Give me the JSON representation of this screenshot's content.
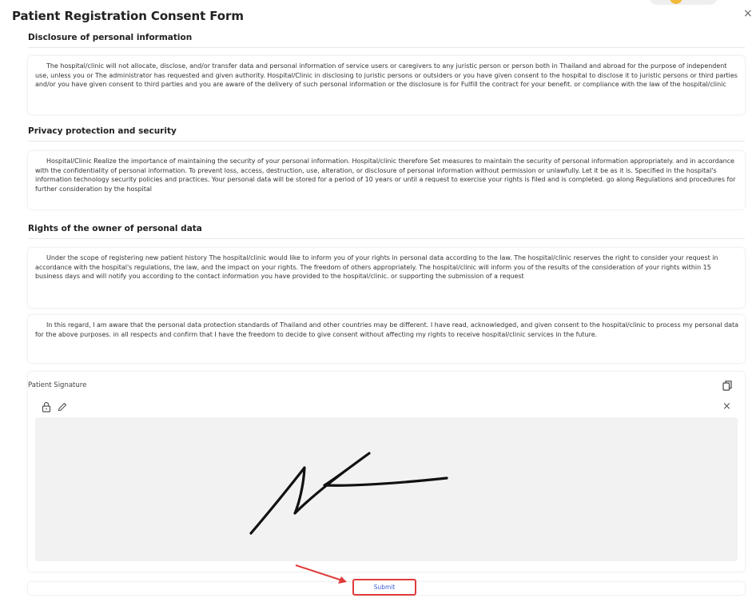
{
  "header": {
    "title": "Patient Registration Consent Form",
    "close_icon": "×"
  },
  "sections": [
    {
      "heading": "Disclosure of personal information",
      "paragraph": "The hospital/clinic will not allocate, disclose, and/or transfer data and personal information of service users or caregivers to any juristic person or person both in Thailand and abroad for the purpose of independent use, unless you or The administrator has requested and given authority. Hospital/Clinic in disclosing to juristic persons or outsiders or you have given consent to the hospital to disclose it to juristic persons or third parties and/or you have given consent to third parties and you are aware of the delivery of such personal information or the disclosure is for Fulfill the contract for your benefit. or compliance with the law of the hospital/clinic"
    },
    {
      "heading": "Privacy protection and security",
      "paragraph": "Hospital/Clinic Realize the importance of maintaining the security of your personal information. Hospital/clinic therefore Set measures to maintain the security of personal information appropriately. and in accordance with the confidentiality of personal information. To prevent loss, access, destruction, use, alteration, or disclosure of personal information without permission or unlawfully. Let it be as it is. Specified in the hospital's information technology security policies and practices. Your personal data will be stored for a period of 10 years or until a request to exercise your rights is filed and is completed. go along Regulations and procedures for further consideration by the hospital"
    },
    {
      "heading": "Rights of the owner of personal data",
      "paragraph": "Under the scope of registering new patient history The hospital/clinic would like to inform you of your rights in personal data according to the law. The hospital/clinic reserves the right to consider your request in accordance with the hospital's regulations, the law, and the impact on your rights. The freedom of others appropriately. The hospital/clinic will inform you of the results of the consideration of your rights within 15 business days and will notify you according to the contact information you have provided to the hospital/clinic. or supporting the submission of a request"
    }
  ],
  "consent_paragraph": "In this regard, I am aware that the personal data protection standards of Thailand and other countries may be different. I have read, acknowledged, and given consent to the hospital/clinic to process my personal data for the above purposes. in all respects and confirm that I have the freedom to decide to give consent without affecting my rights to receive hospital/clinic services in the future.",
  "signature": {
    "label": "Patient Signature",
    "icons": [
      "copy-icon",
      "lock-icon",
      "pencil-icon",
      "clear-icon"
    ],
    "clear_glyph": "×"
  },
  "submit": {
    "label": "Submit"
  },
  "colors": {
    "annotation_red": "#e03b3b",
    "submit_text": "#3d5bd8",
    "pad_background": "#f2f2f2",
    "badge_yellow": "#f3b93b"
  }
}
